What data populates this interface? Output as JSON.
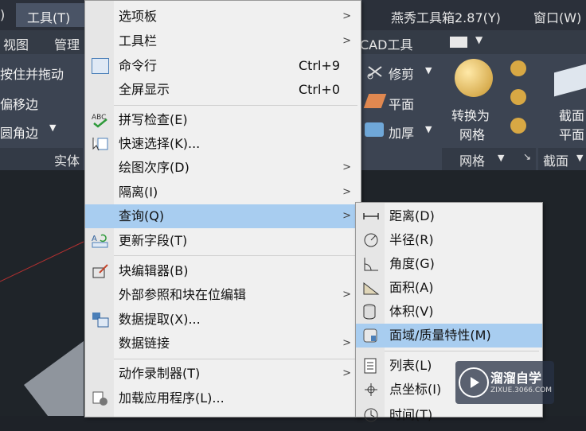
{
  "menubar": {
    "items": [
      ")",
      "工具(T)",
      "燕秀工具箱2.87(Y)",
      "窗口(W)"
    ]
  },
  "tabs": [
    "视图",
    "管理",
    "CAD工具"
  ],
  "ribbon": {
    "left_items": [
      "按住并拖动",
      "偏移边",
      "圆角边"
    ],
    "left_panel": "实体",
    "edit_items": [
      "修剪",
      "平面",
      "加厚"
    ],
    "mesh_button": [
      "转换为",
      "网格"
    ],
    "mesh_panel": "网格",
    "section_button": [
      "截面",
      "平面"
    ],
    "section_panel": "截面"
  },
  "tools_menu": {
    "items": [
      {
        "label": "选项板",
        "submenu": true
      },
      {
        "label": "工具栏",
        "submenu": true
      },
      {
        "label": "命令行",
        "shortcut": "Ctrl+9"
      },
      {
        "label": "全屏显示",
        "shortcut": "Ctrl+0"
      },
      {
        "label": "拼写检查(E)"
      },
      {
        "label": "快速选择(K)..."
      },
      {
        "label": "绘图次序(D)",
        "submenu": true
      },
      {
        "label": "隔离(I)",
        "submenu": true
      },
      {
        "label": "查询(Q)",
        "submenu": true,
        "highlighted": true
      },
      {
        "label": "更新字段(T)"
      },
      {
        "label": "块编辑器(B)"
      },
      {
        "label": "外部参照和块在位编辑",
        "submenu": true
      },
      {
        "label": "数据提取(X)..."
      },
      {
        "label": "数据链接",
        "submenu": true
      },
      {
        "label": "动作录制器(T)",
        "submenu": true
      },
      {
        "label": "加载应用程序(L)..."
      }
    ]
  },
  "query_menu": {
    "items": [
      {
        "label": "距离(D)"
      },
      {
        "label": "半径(R)"
      },
      {
        "label": "角度(G)"
      },
      {
        "label": "面积(A)"
      },
      {
        "label": "体积(V)"
      },
      {
        "label": "面域/质量特性(M)",
        "highlighted": true
      },
      {
        "label": "列表(L)"
      },
      {
        "label": "点坐标(I)"
      },
      {
        "label": "时间(T)"
      }
    ]
  },
  "watermark": {
    "title": "溜溜自学",
    "url": "ZIXUE.3066.COM"
  }
}
